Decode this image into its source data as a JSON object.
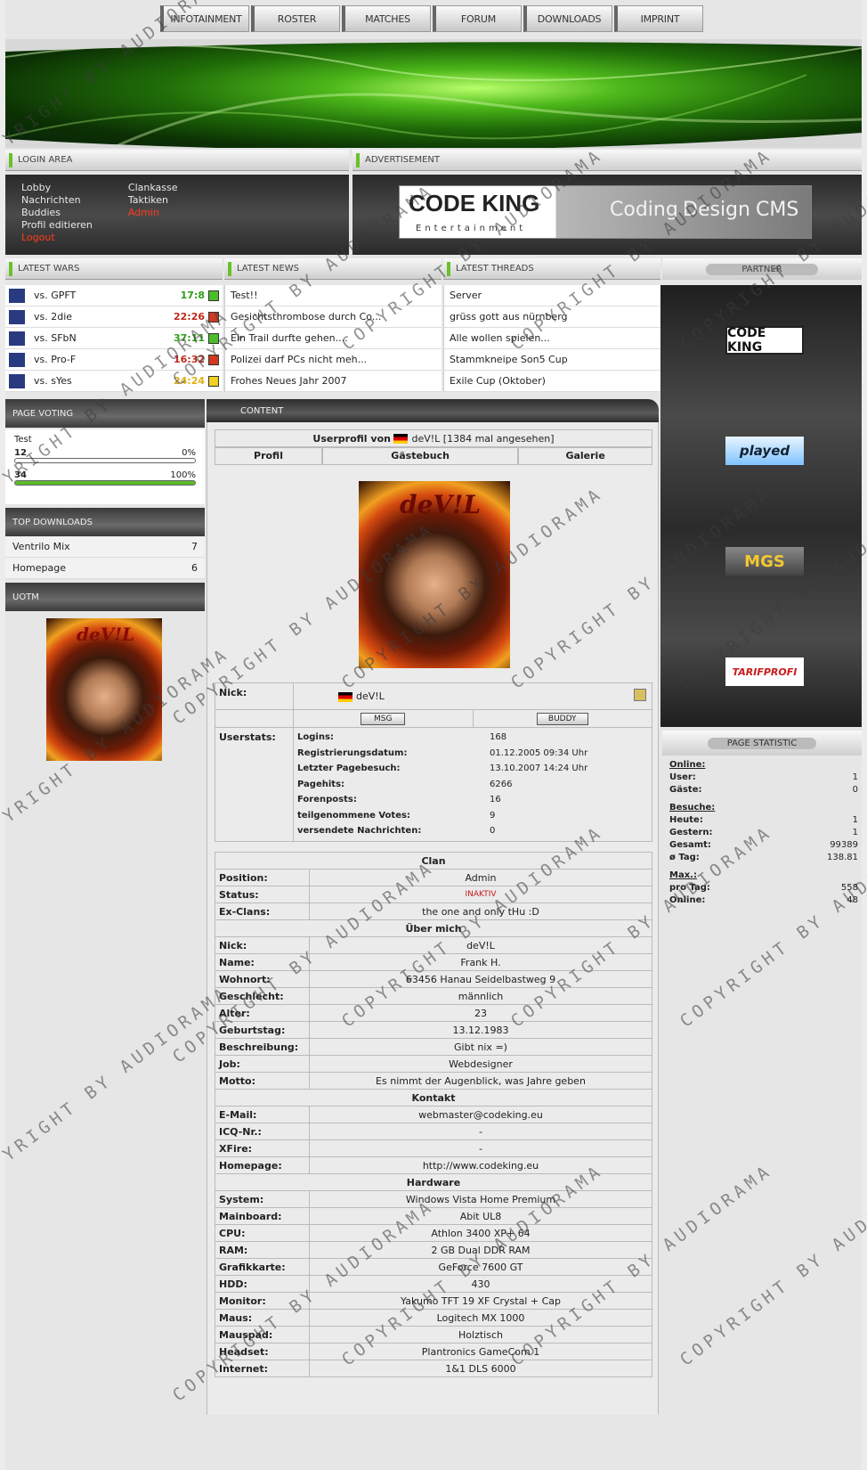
{
  "nav": [
    "INFOTAINMENT",
    "ROSTER",
    "MATCHES",
    "FORUM",
    "DOWNLOADS",
    "IMPRINT"
  ],
  "headers": {
    "login": "LOGIN AREA",
    "ad": "ADVERTISEMENT",
    "wars": "LATEST WARS",
    "news": "LATEST NEWS",
    "threads": "LATEST THREADS",
    "partner": "PARTNER",
    "voting": "PAGE VOTING",
    "downloads": "TOP DOWNLOADS",
    "uotm": "UOTM",
    "content": "CONTENT",
    "stats": "PAGE STATISTIC"
  },
  "login_col1": [
    "Lobby",
    "Nachrichten",
    "Buddies",
    "Profil editieren",
    "Logout"
  ],
  "login_col2": [
    "Clankasse",
    "Taktiken",
    "Admin"
  ],
  "ad": {
    "brand": "CODE KING",
    "sub": "Entertainment",
    "words": [
      "Coding",
      "Design",
      "CMS"
    ]
  },
  "wars": [
    {
      "opponent": "vs. GPFT",
      "score": "17:8",
      "color": "#2e9e16"
    },
    {
      "opponent": "vs. 2die",
      "score": "22:26",
      "color": "#c0281a"
    },
    {
      "opponent": "vs. SFbN",
      "score": "37:11",
      "color": "#2e9e16"
    },
    {
      "opponent": "vs. Pro-F",
      "score": "16:32",
      "color": "#c0281a"
    },
    {
      "opponent": "vs. sYes",
      "score": "24:24",
      "color": "#e0b010"
    }
  ],
  "news": [
    "Test!!",
    "Gesichtsthrombose durch Co...",
    "Ein Trail durfte gehen....",
    "Polizei darf PCs nicht meh...",
    "Frohes Neues Jahr 2007"
  ],
  "threads": [
    "Server",
    "grüss gott aus nürnberg",
    "Alle wollen spielen...",
    "Stammkneipe Son5 Cup",
    "Exile Cup (Oktober)"
  ],
  "partners": [
    "CODE KING",
    "played",
    "MGS",
    "TARIFPROFI"
  ],
  "voting": {
    "question": "Test",
    "options": [
      {
        "count": "12",
        "percent": "0%",
        "fill": 0
      },
      {
        "count": "34",
        "percent": "100%",
        "fill": 1
      }
    ]
  },
  "downloads": [
    {
      "name": "Ventrilo Mix",
      "count": "7"
    },
    {
      "name": "Homepage",
      "count": "6"
    }
  ],
  "uotm": {
    "caption": "deV!L"
  },
  "profile": {
    "title_prefix": "Userprofil von",
    "nick": "deV!L",
    "views": "[1384 mal angesehen]",
    "tabs": [
      "Profil",
      "Gästebuch",
      "Galerie"
    ],
    "photo_caption": "deV!L",
    "nick_label": "Nick:",
    "msg": "MSG",
    "buddy": "BUDDY",
    "stats_label": "Userstats:",
    "stats": [
      [
        "Logins:",
        "168"
      ],
      [
        "Registrierungsdatum:",
        "01.12.2005 09:34 Uhr"
      ],
      [
        "Letzter Pagebesuch:",
        "13.10.2007 14:24 Uhr"
      ],
      [
        "Pagehits:",
        "6266"
      ],
      [
        "Forenposts:",
        "16"
      ],
      [
        "teilgenommene Votes:",
        "9"
      ],
      [
        "versendete Nachrichten:",
        "0"
      ]
    ],
    "sections": [
      {
        "title": "Clan",
        "rows": [
          [
            "Position:",
            "Admin"
          ],
          [
            "Status:",
            "INAKTIV"
          ],
          [
            "Ex-Clans:",
            "the one and only tHu :D"
          ]
        ]
      },
      {
        "title": "Über mich",
        "rows": [
          [
            "Nick:",
            "deV!L"
          ],
          [
            "Name:",
            "Frank H."
          ],
          [
            "Wohnort:",
            "63456 Hanau Seidelbastweg 9"
          ],
          [
            "Geschlecht:",
            "männlich"
          ],
          [
            "Alter:",
            "23"
          ],
          [
            "Geburtstag:",
            "13.12.1983"
          ],
          [
            "Beschreibung:",
            "Gibt nix =)"
          ],
          [
            "Job:",
            "Webdesigner"
          ],
          [
            "Motto:",
            "Es nimmt der Augenblick, was Jahre geben"
          ]
        ]
      },
      {
        "title": "Kontakt",
        "rows": [
          [
            "E-Mail:",
            "webmaster@codeking.eu"
          ],
          [
            "ICQ-Nr.:",
            "-"
          ],
          [
            "XFire:",
            "-"
          ],
          [
            "Homepage:",
            "http://www.codeking.eu"
          ]
        ]
      },
      {
        "title": "Hardware",
        "rows": [
          [
            "System:",
            "Windows Vista Home Premium"
          ],
          [
            "Mainboard:",
            "Abit UL8"
          ],
          [
            "CPU:",
            "Athlon 3400 XP+ 64"
          ],
          [
            "RAM:",
            "2 GB Dual DDR RAM"
          ],
          [
            "Grafikkarte:",
            "GeForce 7600 GT"
          ],
          [
            "HDD:",
            "430"
          ],
          [
            "Monitor:",
            "Yakumo TFT 19 XF Crystal + Cap"
          ],
          [
            "Maus:",
            "Logitech MX 1000"
          ],
          [
            "Mauspad:",
            "Holztisch"
          ],
          [
            "Headset:",
            "Plantronics GameCom 1"
          ],
          [
            "Internet:",
            "1&1 DLS 6000"
          ]
        ]
      }
    ]
  },
  "statistic": {
    "online_title": "Online:",
    "online": [
      [
        "User:",
        "1"
      ],
      [
        "Gäste:",
        "0"
      ]
    ],
    "visits_title": "Besuche:",
    "visits": [
      [
        "Heute:",
        "1"
      ],
      [
        "Gestern:",
        "1"
      ],
      [
        "Gesamt:",
        "99389"
      ],
      [
        "ø Tag:",
        "138.81"
      ]
    ],
    "max_title": "Max.:",
    "max": [
      [
        "pro Tag:",
        "558"
      ],
      [
        "Online:",
        "48"
      ]
    ]
  },
  "watermark": "COPYRIGHT BY AUDIORAMA"
}
